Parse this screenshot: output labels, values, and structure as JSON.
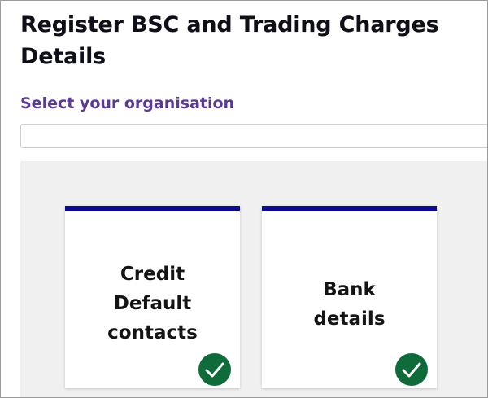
{
  "page": {
    "title": "Register BSC and Trading Charges Details"
  },
  "organisation": {
    "label": "Select your organisation",
    "value": "",
    "placeholder": ""
  },
  "tiles": [
    {
      "label": "Credit\nDefault\ncontacts",
      "status_icon": "check-circle-icon",
      "status": "complete"
    },
    {
      "label": "Bank\ndetails",
      "status_icon": "check-circle-icon",
      "status": "complete"
    }
  ],
  "colors": {
    "accent_bar": "#0c0c8c",
    "label_purple": "#5b3a96",
    "check_green": "#0f6b3a",
    "panel_bg": "#f0f0f0"
  }
}
